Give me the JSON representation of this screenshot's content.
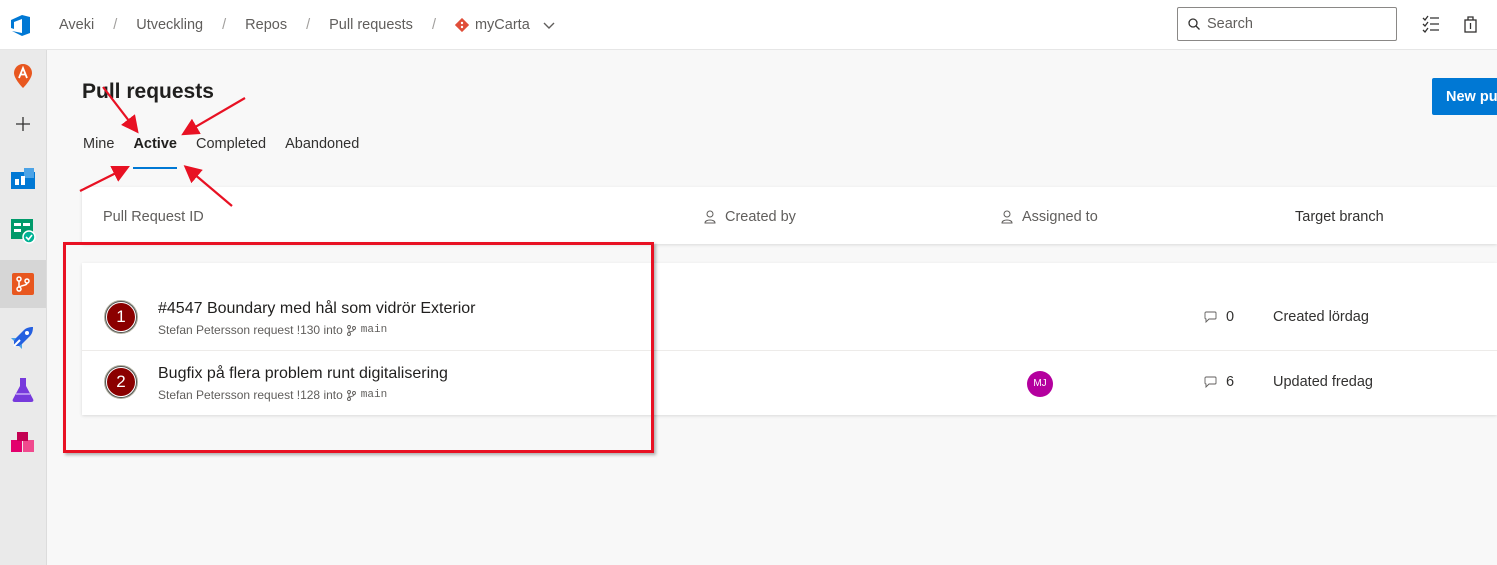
{
  "breadcrumb": {
    "items": [
      "Aveki",
      "Utveckling",
      "Repos",
      "Pull requests"
    ],
    "repo": "myCarta"
  },
  "search": {
    "placeholder": "Search"
  },
  "page": {
    "title": "Pull requests",
    "new_button": "New pull request"
  },
  "tabs": [
    "Mine",
    "Active",
    "Completed",
    "Abandoned"
  ],
  "active_tab": "Active",
  "columns": {
    "id": "Pull Request ID",
    "created_by": "Created by",
    "assigned_to": "Assigned to",
    "target_branch": "Target branch"
  },
  "rows": [
    {
      "number": "1",
      "title": "#4547 Boundary med hål som vidrör Exterior",
      "subtitle": "Stefan Petersson request !130 into",
      "branch": "main",
      "reviewer": "",
      "comments": "0",
      "status": "Created lördag"
    },
    {
      "number": "2",
      "title": "Bugfix på flera problem runt digitalisering",
      "subtitle": "Stefan Petersson request !128 into",
      "branch": "main",
      "reviewer": "MJ",
      "comments": "6",
      "status": "Updated fredag"
    }
  ],
  "colors": {
    "accent": "#0078d4",
    "annotation": "#e81123",
    "reviewer_avatar": "#b4009e"
  }
}
